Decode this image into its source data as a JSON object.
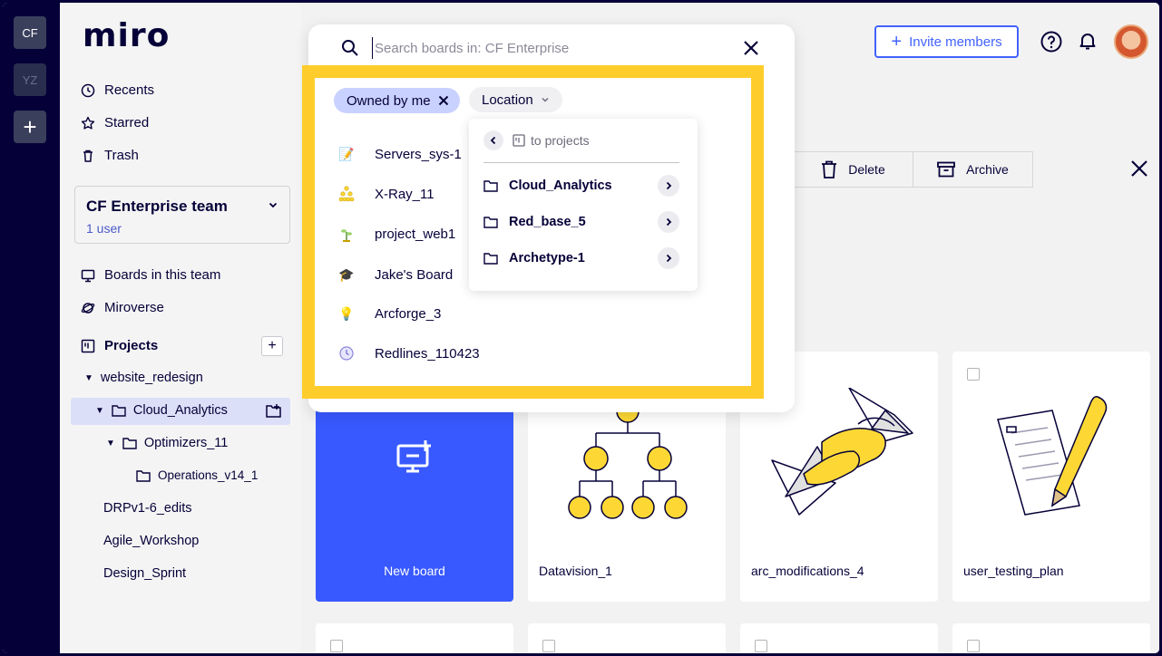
{
  "rail": {
    "workspaces": [
      "CF",
      "YZ"
    ],
    "add_label": "+"
  },
  "sidebar": {
    "logo": "miro",
    "nav": [
      "Recents",
      "Starred",
      "Trash"
    ],
    "team": {
      "name": "CF Enterprise team",
      "users": "1 user"
    },
    "links": [
      "Boards in this team",
      "Miroverse"
    ],
    "projects_label": "Projects",
    "tree": [
      "website_redesign",
      "Cloud_Analytics",
      "Optimizers_11",
      "Operations_v14_1",
      "DRPv1-6_edits",
      "Agile_Workshop",
      "Design_Sprint"
    ]
  },
  "header": {
    "invite_label": "Invite members"
  },
  "toolbar": {
    "delete_label": "Delete",
    "archive_label": "Archive"
  },
  "boards": {
    "new_board_label": "New board",
    "cards": [
      "Datavision_1",
      "arc_modifications_4",
      "user_testing_plan"
    ]
  },
  "search": {
    "placeholder": "Search boards in: CF Enterprise",
    "filter_chip": "Owned by me",
    "location_chip": "Location",
    "results": [
      {
        "name": "Servers_sys-1",
        "icon": "memo-icon"
      },
      {
        "name": "X-Ray_11",
        "icon": "org-chart-icon"
      },
      {
        "name": "project_web1",
        "icon": "plant-icon"
      },
      {
        "name": "Jake's Board",
        "icon": "grad-cap-icon"
      },
      {
        "name": "Arcforge_3",
        "icon": "bulb-icon"
      },
      {
        "name": "Redlines_110423",
        "icon": "clock-icon"
      }
    ],
    "location_dropdown": {
      "back_label": "to projects",
      "folders": [
        "Cloud_Analytics",
        "Red_base_5",
        "Archetype-1"
      ]
    }
  },
  "colors": {
    "highlight": "#ffcd2b",
    "accent": "#4262ff",
    "new_board": "#3859ff",
    "ink": "#050038"
  }
}
